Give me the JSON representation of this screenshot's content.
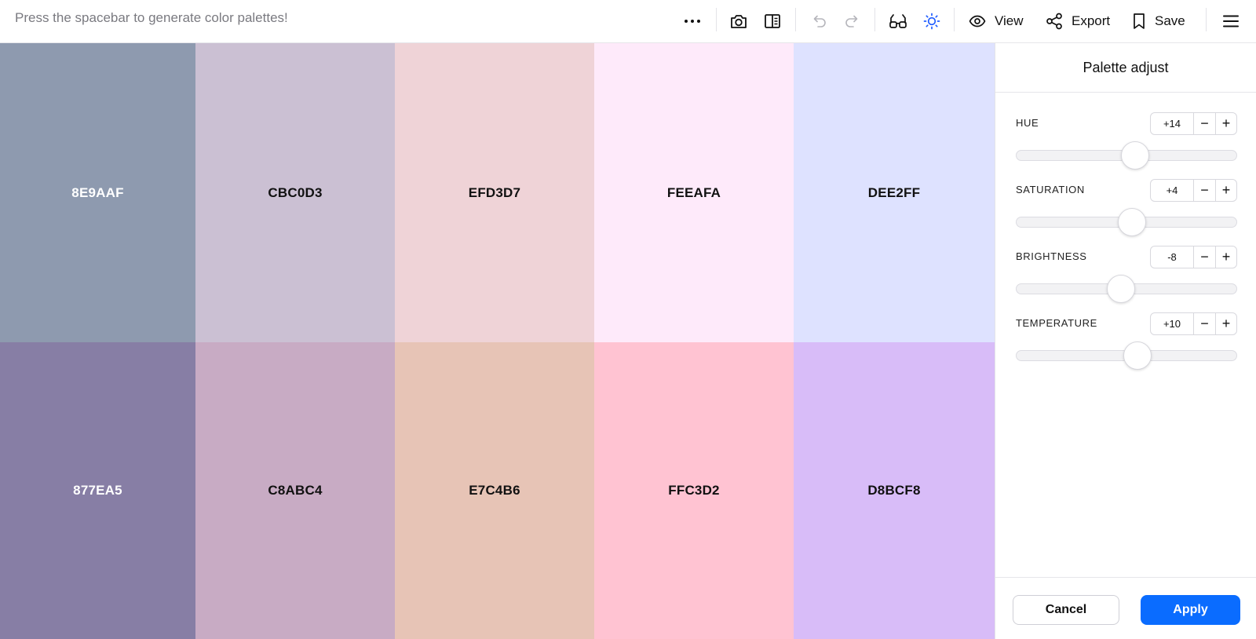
{
  "toolbar": {
    "hint": "Press the spacebar to generate color palettes!",
    "view_label": "View",
    "export_label": "Export",
    "save_label": "Save",
    "icons": [
      "more-icon",
      "camera-icon",
      "side-panel-icon",
      "undo-icon",
      "redo-icon",
      "glasses-icon",
      "sun-icon",
      "eye-icon",
      "share-icon",
      "bookmark-icon",
      "menu-icon"
    ],
    "active_icon_color": "#1f5cff"
  },
  "palette": {
    "row1": [
      {
        "hex": "8E9AAF",
        "color": "#8E9AAF",
        "text_color": "#FFFFFF"
      },
      {
        "hex": "CBC0D3",
        "color": "#CBC0D3",
        "text_color": "#111111"
      },
      {
        "hex": "EFD3D7",
        "color": "#EFD3D7",
        "text_color": "#111111"
      },
      {
        "hex": "FEEAFA",
        "color": "#FEEAFA",
        "text_color": "#111111"
      },
      {
        "hex": "DEE2FF",
        "color": "#DEE2FF",
        "text_color": "#111111"
      }
    ],
    "row2": [
      {
        "hex": "877EA5",
        "color": "#877EA5",
        "text_color": "#FFFFFF"
      },
      {
        "hex": "C8ABC4",
        "color": "#C8ABC4",
        "text_color": "#111111"
      },
      {
        "hex": "E7C4B6",
        "color": "#E7C4B6",
        "text_color": "#111111"
      },
      {
        "hex": "FFC3D2",
        "color": "#FFC3D2",
        "text_color": "#111111"
      },
      {
        "hex": "D8BCF8",
        "color": "#D8BCF8",
        "text_color": "#111111"
      }
    ]
  },
  "panel": {
    "title": "Palette adjust",
    "adjustments": [
      {
        "name": "HUE",
        "value": "+14",
        "slider_fraction": 0.54
      },
      {
        "name": "SATURATION",
        "value": "+4",
        "slider_fraction": 0.525
      },
      {
        "name": "BRIGHTNESS",
        "value": "-8",
        "slider_fraction": 0.475
      },
      {
        "name": "TEMPERATURE",
        "value": "+10",
        "slider_fraction": 0.55
      }
    ],
    "minus_label": "−",
    "plus_label": "+",
    "cancel_label": "Cancel",
    "apply_label": "Apply",
    "accent_color": "#0A6CFF"
  }
}
